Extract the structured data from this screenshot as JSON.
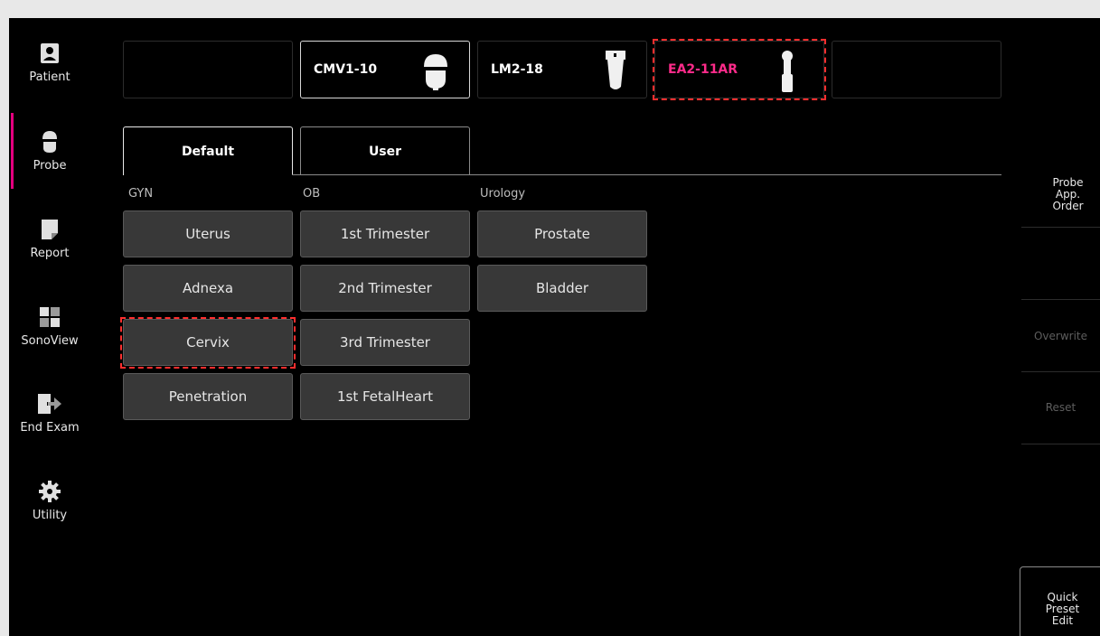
{
  "sidebar": {
    "items": [
      {
        "label": "Patient",
        "icon": "patient-icon"
      },
      {
        "label": "Probe",
        "icon": "probe-icon",
        "active": true
      },
      {
        "label": "Report",
        "icon": "report-icon"
      },
      {
        "label": "SonoView",
        "icon": "sonoview-icon"
      },
      {
        "label": "End Exam",
        "icon": "end-exam-icon"
      },
      {
        "label": "Utility",
        "icon": "gear-icon"
      }
    ],
    "accent_color": "#e4007f"
  },
  "probes": {
    "slots": [
      {
        "label": ""
      },
      {
        "label": "CMV1-10",
        "selected": true
      },
      {
        "label": "LM2-18"
      },
      {
        "label": "EA2-11AR",
        "highlight_color": "#ff2b8a"
      },
      {
        "label": ""
      }
    ]
  },
  "tabs": [
    {
      "label": "Default",
      "active": true
    },
    {
      "label": "User"
    }
  ],
  "groups": [
    {
      "name": "GYN",
      "presets": [
        "Uterus",
        "Adnexa",
        "Cervix",
        "Penetration"
      ]
    },
    {
      "name": "OB",
      "presets": [
        "1st Trimester",
        "2nd Trimester",
        "3rd Trimester",
        "1st FetalHeart"
      ]
    },
    {
      "name": "Urology",
      "presets": [
        "Prostate",
        "Bladder"
      ]
    }
  ],
  "right_panel": {
    "probe_app_order": "Probe App. Order",
    "overwrite": "Overwrite",
    "reset": "Reset",
    "quick_preset_edit": "Quick Preset Edit"
  }
}
